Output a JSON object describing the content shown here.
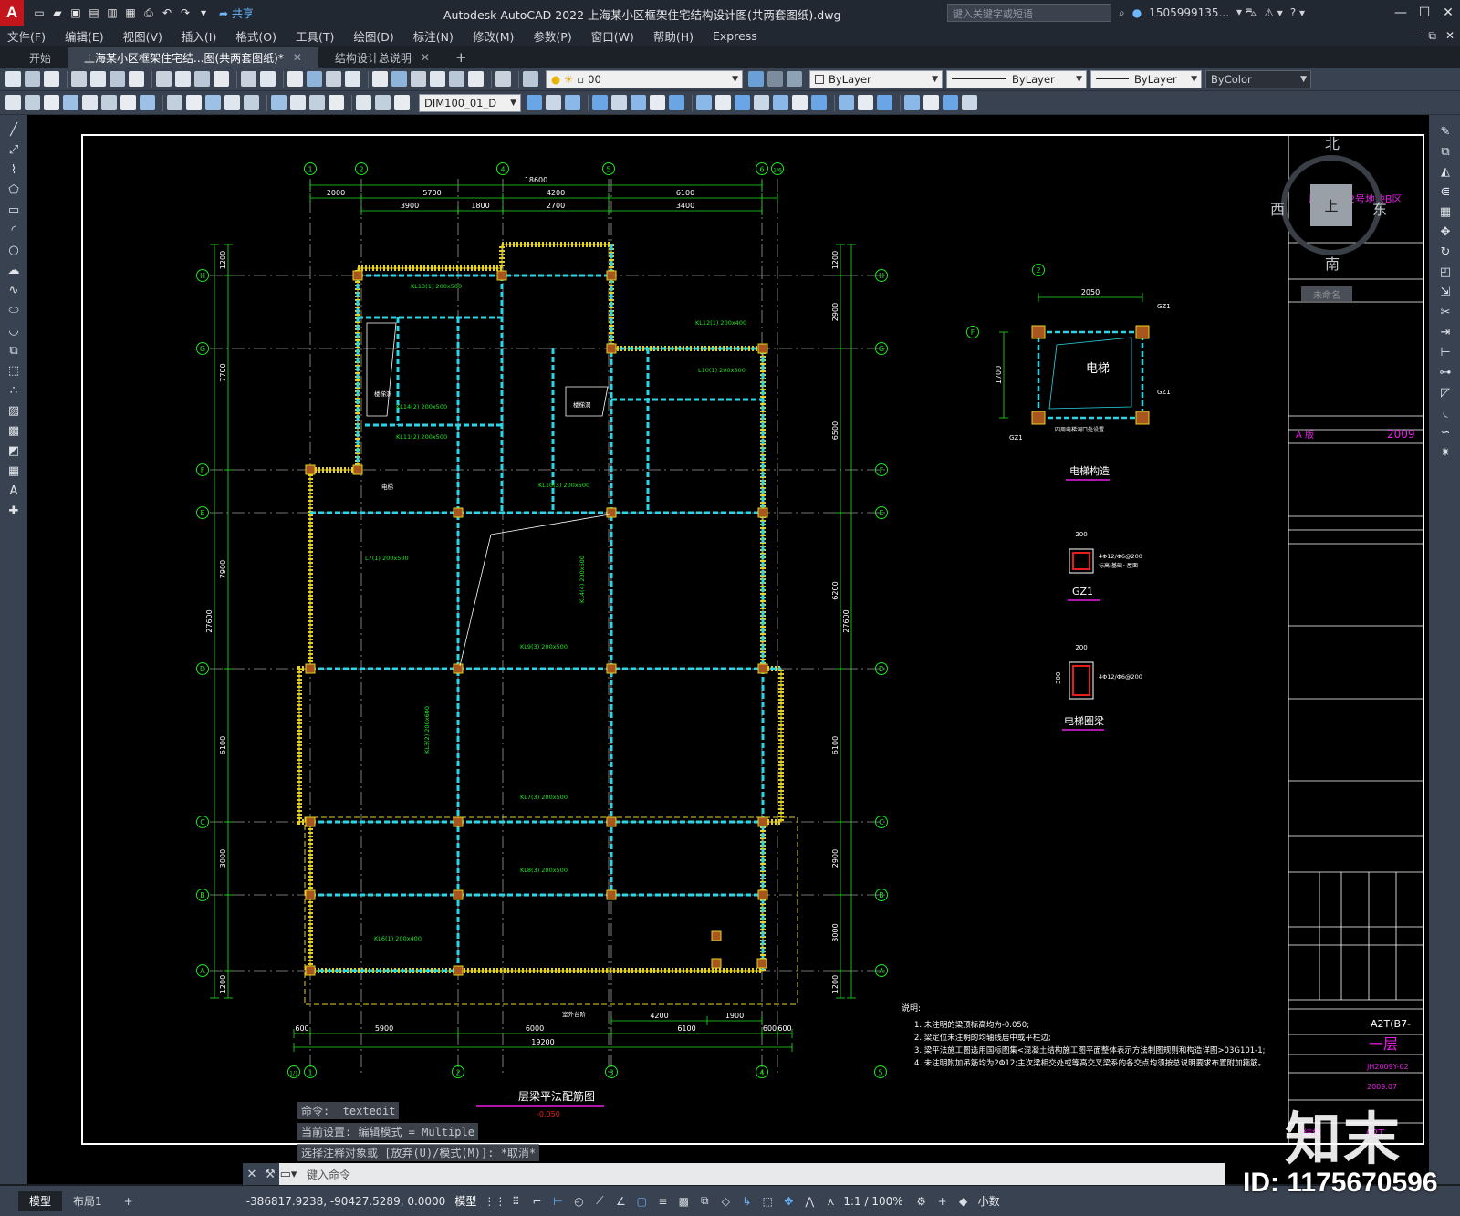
{
  "app": {
    "logo": "A",
    "title": "Autodesk AutoCAD 2022    上海某小区框架住宅结构设计图(共两套图纸).dwg",
    "share_label": "共享",
    "search_placeholder": "键入关键字或短语",
    "user": "1505999135...",
    "accent": "#c3161c"
  },
  "menu": [
    "文件(F)",
    "编辑(E)",
    "视图(V)",
    "插入(I)",
    "格式(O)",
    "工具(T)",
    "绘图(D)",
    "标注(N)",
    "修改(M)",
    "参数(P)",
    "窗口(W)",
    "帮助(H)",
    "Express"
  ],
  "tabs": [
    {
      "label": "开始"
    },
    {
      "label": "上海某小区框架住宅结...图(共两套图纸)*"
    },
    {
      "label": "结构设计总说明"
    }
  ],
  "properties": {
    "layer": "00",
    "color": "ByLayer",
    "linetype": "ByLayer",
    "lineweight": "ByLayer",
    "plotstyle": "ByColor",
    "dimstyle": "DIM100_01_D"
  },
  "viewcube": {
    "north": "北",
    "south": "南",
    "east": "东",
    "west": "西",
    "top": "上",
    "ucs": "未命名"
  },
  "drawing": {
    "title": "一层梁平法配筋图",
    "elevation": "-0.050",
    "overall_width": "18600",
    "overall_bottom": "19200",
    "overall_height": "27600",
    "top_dims": [
      "2000",
      "5700",
      "4200",
      "6100"
    ],
    "top_dims2": [
      "3900",
      "1800",
      "2700",
      "3400"
    ],
    "bottom_dims": [
      "600",
      "5900",
      "6000",
      "6100",
      "600",
      "600"
    ],
    "bottom_dims2": [
      "4200",
      "1900"
    ],
    "left_dims": [
      "1200",
      "7700",
      "7900",
      "6100",
      "3000",
      "1200"
    ],
    "right_dims": [
      "1200",
      "2900",
      "6500",
      "6200",
      "6100",
      "2900",
      "3000",
      "1200"
    ],
    "axes_top": [
      "1",
      "2",
      "4",
      "5",
      "6",
      "1/6"
    ],
    "axes_bottom": [
      "1/1",
      "1",
      "2",
      "3",
      "4",
      "5"
    ],
    "axes_side": [
      "H",
      "G",
      "F",
      "E",
      "D",
      "C",
      "B",
      "A"
    ],
    "beams": [
      "KL13(1) 200x500",
      "KL12(1) 200x400",
      "L10(1) 200x500",
      "KL14(2) 200x500",
      "KL11(2) 200x500",
      "KL10(3) 200x500",
      "L7(1) 200x500",
      "KL9(3) 200x500",
      "KL4(4) 200x600",
      "KL3(2) 200x600",
      "KL7(3) 200x500",
      "KL6(1) 200x400",
      "KL8(3) 200x500"
    ],
    "elevator": {
      "label": "电梯",
      "caption": "电梯构造",
      "dim": "2050",
      "dim_v": "1700",
      "col": "GZ1",
      "note": "四周电梯洞口处设置"
    },
    "gz1": {
      "caption": "GZ1",
      "dim": "200",
      "rebar": "4Φ12/Φ6@200",
      "note": "标高:基础~屋面"
    },
    "ring_beam": {
      "caption": "电梯圈梁",
      "dim": "200",
      "dim_v": "300",
      "rebar": "4Φ12/Φ6@200"
    },
    "notes": {
      "heading": "说明:",
      "items": [
        "1. 未注明的梁顶标高均为-0.050;",
        "2. 梁定位未注明的均轴线居中或平柱边;",
        "3. 梁平法施工图选用国标图集<混凝土结构施工图平面整体表示方法制图规则和构造详图>03G101-1;",
        "4. 未注明附加吊筋均为2Φ12;主次梁相交处或等高交叉梁系的各交点均须按总说明要求布置附加箍筋。"
      ]
    },
    "titleblock": {
      "stamp": "A  版",
      "year": "2009",
      "code": "A2T(B7-",
      "sheet_title": "一层",
      "num1": "JH2009Y-02",
      "num2": "2009.07",
      "discipline": "结施",
      "size": "A2T"
    },
    "label_magenta": "居住小区2号地块B区",
    "stair_label": "楼梯洞",
    "outdoor_label": "室外台阶"
  },
  "command": {
    "history": [
      "命令: _textedit",
      "当前设置: 编辑模式 = Multiple",
      "选择注释对象或 [放弃(U)/模式(M)]: *取消*"
    ],
    "placeholder": "键入命令"
  },
  "status": {
    "layouts": [
      "模型",
      "布局1"
    ],
    "coords": "-386817.9238, -90427.5289, 0.0000",
    "mode": "模型",
    "scale": "1:1 / 100%",
    "units": "小数"
  },
  "watermark": {
    "id": "ID: 1175670596",
    "logo": "知末"
  }
}
